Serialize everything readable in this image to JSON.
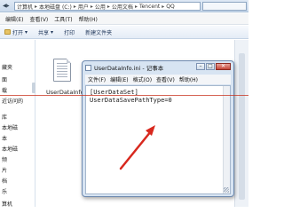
{
  "explorer": {
    "breadcrumbs": [
      "计算机",
      "本地磁盘 (C:)",
      "用户",
      "公用",
      "公用文档",
      "Tencent",
      "QQ"
    ],
    "menu": [
      "编辑(E)",
      "查看(V)",
      "工具(T)",
      "帮助(H)"
    ],
    "toolbar": {
      "open": "打开",
      "share": "共享",
      "print": "打印",
      "new_folder": "新建文件夹"
    },
    "nav_items": [
      "藏夹",
      "面",
      "载",
      "近访问的",
      "库",
      "本地磁",
      "本",
      "本地磁",
      "频",
      "片",
      "档",
      "乐",
      "算机",
      "本地磁盘"
    ],
    "file": {
      "name": "UserDataInfo.ini",
      "icon": "ini-file-icon"
    }
  },
  "notepad": {
    "title": "UserDataInfo.ini - 记事本",
    "menu": [
      "文件(F)",
      "编辑(E)",
      "格式(O)",
      "查看(V)",
      "帮助(H)"
    ],
    "lines": [
      "[UserDataSet]",
      "UserDataSavePathType=0"
    ]
  },
  "annotations": {
    "arrow_color": "#d8281e"
  }
}
